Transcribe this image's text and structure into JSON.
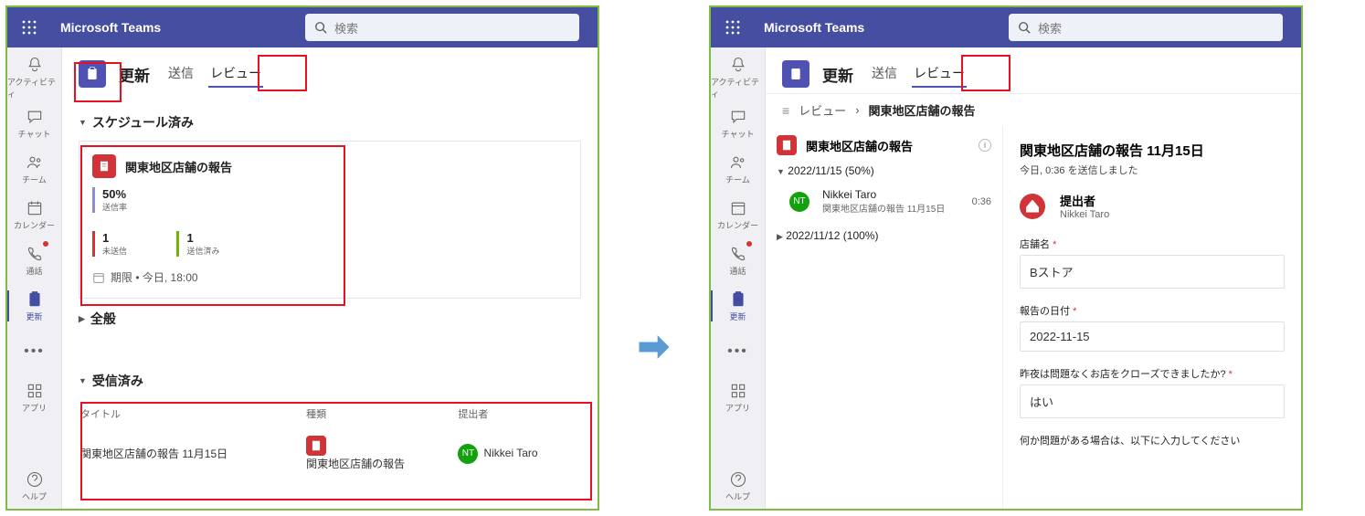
{
  "app": {
    "name": "Microsoft Teams",
    "search_placeholder": "検索"
  },
  "rail": {
    "activity": "アクティビティ",
    "chat": "チャット",
    "teams": "チーム",
    "calendar": "カレンダー",
    "calls": "通話",
    "updates": "更新",
    "apps": "アプリ",
    "help": "ヘルプ"
  },
  "page": {
    "app_label": "更新",
    "tabs": {
      "send": "送信",
      "review": "レビュー"
    }
  },
  "left_screen": {
    "section_scheduled": "スケジュール済み",
    "card": {
      "title": "関東地区店舗の報告",
      "rate_value": "50%",
      "rate_label": "送信率",
      "unsent_value": "1",
      "unsent_label": "未送信",
      "sent_value": "1",
      "sent_label": "送信済み",
      "deadline": "期限 • 今日, 18:00"
    },
    "section_general": "全般",
    "section_received": "受信済み",
    "table": {
      "col_title": "タイトル",
      "col_type": "種類",
      "col_submitter": "提出者",
      "row": {
        "title": "関東地区店舗の報告 11月15日",
        "type": "関東地区店舗の報告",
        "avatar_initials": "NT",
        "submitter": "Nikkei Taro"
      }
    }
  },
  "right_screen": {
    "breadcrumb": {
      "root": "レビュー",
      "sep": "›",
      "leaf": "関東地区店舗の報告"
    },
    "left_pane": {
      "title": "関東地区店舗の報告",
      "group1": "2022/11/15 (50%)",
      "entry": {
        "initials": "NT",
        "name": "Nikkei Taro",
        "sub": "関東地区店舗の報告 11月15日",
        "time": "0:36"
      },
      "group2": "2022/11/12 (100%)"
    },
    "detail": {
      "heading": "関東地区店舗の報告 11月15日",
      "sent": "今日, 0:36 を送信しました",
      "submitter_label": "提出者",
      "submitter_name": "Nikkei Taro",
      "f1_label": "店舗名",
      "f1_value": "Bストア",
      "f2_label": "報告の日付",
      "f2_value": "2022-11-15",
      "f3_label": "昨夜は問題なくお店をクローズできましたか?",
      "f3_value": "はい",
      "f4_label": "何か問題がある場合は、以下に入力してください"
    }
  }
}
